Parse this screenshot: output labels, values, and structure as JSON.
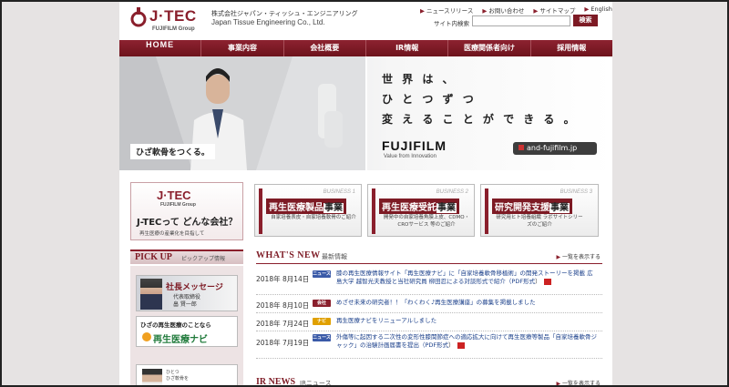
{
  "header": {
    "logo_text": "J·TEC",
    "logo_sub": "FUJIFILM Group",
    "company_jp": "株式会社ジャパン・ティッシュ・エンジニアリング",
    "company_en": "Japan Tissue Engineering Co., Ltd.",
    "top_links": [
      "ニュースリリース",
      "お問い合わせ",
      "サイトマップ",
      "English"
    ],
    "search_label": "サイト内検索",
    "search_button": "検索"
  },
  "nav": {
    "items": [
      "HOME",
      "事業内容",
      "会社概要",
      "IR情報",
      "医療関係者向け",
      "採用情報"
    ]
  },
  "hero": {
    "tag": "ひざ軟骨をつくる。",
    "copy_lines": [
      "世 界 は 、",
      "ひ と つ ず つ",
      "変 え る こ と が で き る 。"
    ],
    "brand": "FUJIFILM",
    "brand_sub": "Value from Innovation",
    "url": "and-fujifilm.jp"
  },
  "about": {
    "logo": "J·TEC",
    "logo_sub": "FUJIFILM Group",
    "title": "J-TECって どんな会社？",
    "desc": "再生医療の産業化を目指して"
  },
  "business": [
    {
      "num": "BUSINESS 1",
      "title_a": "再生医療製品",
      "title_b": "事業",
      "desc": "自家培養表皮・自家培養軟骨のご紹介"
    },
    {
      "num": "BUSINESS 2",
      "title_a": "再生医療受託",
      "title_b": "事業",
      "desc": "開発中の自家培養角膜上皮、CDMO・CROサービス 等のご紹介"
    },
    {
      "num": "BUSINESS 3",
      "title_a": "研究開発支援",
      "title_b": "事業",
      "desc": "研究用ヒト培養組織 ラボサイトシリーズのご紹介"
    }
  ],
  "pickup": {
    "title": "PICK UP",
    "sub": "ピックアップ情報",
    "message_title": "社長メッセージ",
    "message_sub": [
      "代表取締役",
      "畠 賢一郎"
    ],
    "navi_top": "ひざの再生医療のことなら",
    "navi_brand": "再生医療ナビ",
    "third_text": [
      "ひとつ",
      "ひざ軟骨を"
    ]
  },
  "whats_new": {
    "title": "WHAT'S NEW",
    "sub": "最新情報",
    "more": "一覧を表示する",
    "items": [
      {
        "date": "2018年 8月14日",
        "cat": "ニュース",
        "cat_color": "#3a5aa8",
        "text": "膝の再生医療情報サイト「再生医療ナビ」に「自家培養軟骨移植術」の開発ストーリーを掲載 広島大学 越智光夫教授と当社研究員 柳田忍による対談形式で紹介（PDF形式",
        "pdf": true
      },
      {
        "date": "2018年 8月10日",
        "cat": "会社",
        "cat_color": "#8a1f2c",
        "text": "めざせ未来の研究者！！「わくわく♪再生医療講座」の募集を掲載しました",
        "pdf": false
      },
      {
        "date": "2018年 7月24日",
        "cat": "ナビ",
        "cat_color": "#e0a000",
        "text": "再生医療ナビをリニューアルしました",
        "pdf": false
      },
      {
        "date": "2018年 7月19日",
        "cat": "ニュース",
        "cat_color": "#3a5aa8",
        "text": "外傷等に起因する二次性の変形性膝関節症への適応拡大に向けて再生医療等製品「自家培養軟骨ジャック」の治験計画届書を提出（PDF形式",
        "pdf": true
      }
    ]
  },
  "ir_news": {
    "title": "IR NEWS",
    "sub": "IRニュース",
    "more": "一覧を表示する"
  },
  "colors": {
    "brand": "#8a1f2c",
    "nav_bg": "#7d1a24"
  }
}
